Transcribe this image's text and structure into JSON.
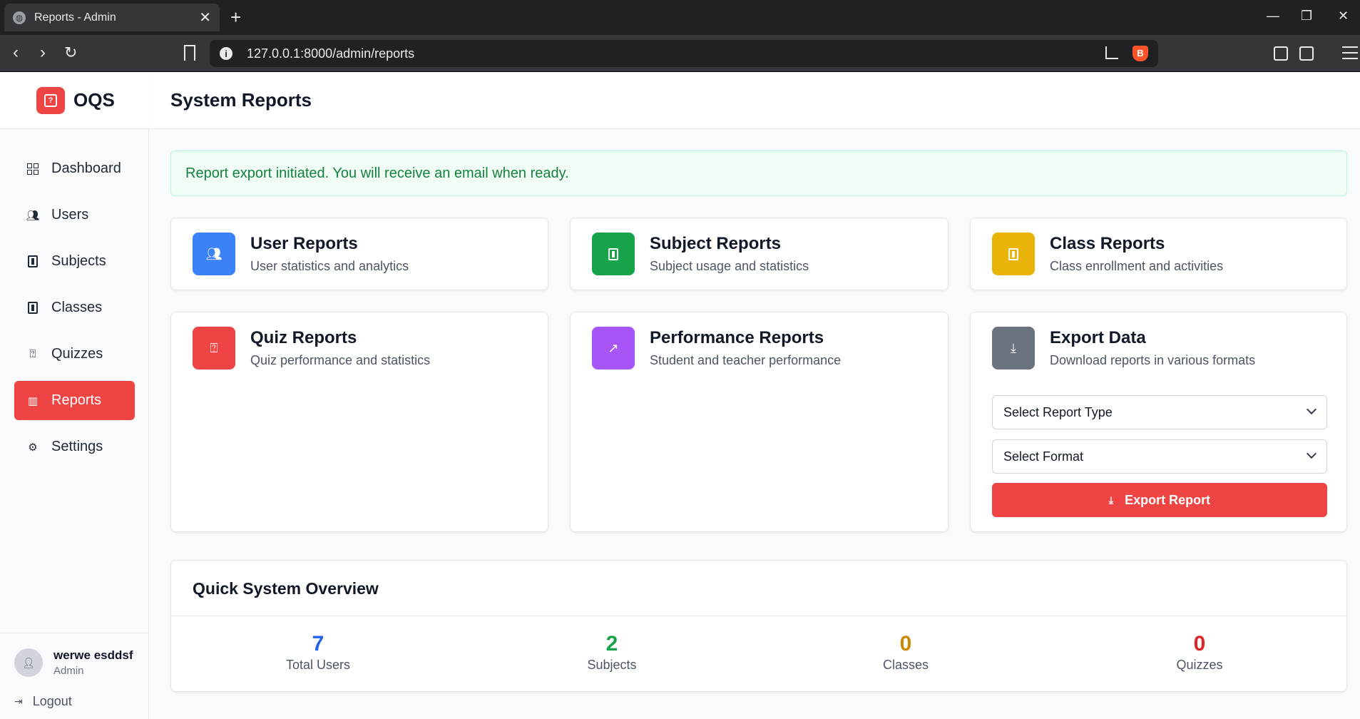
{
  "browser": {
    "tab_title": "Reports - Admin",
    "url": "127.0.0.1:8000/admin/reports"
  },
  "brand": {
    "name": "OQS"
  },
  "sidebar": {
    "items": [
      {
        "label": "Dashboard",
        "icon": "dashboard-icon"
      },
      {
        "label": "Users",
        "icon": "users-icon"
      },
      {
        "label": "Subjects",
        "icon": "book-icon"
      },
      {
        "label": "Classes",
        "icon": "book-icon"
      },
      {
        "label": "Quizzes",
        "icon": "quiz-icon"
      },
      {
        "label": "Reports",
        "icon": "chart-icon",
        "active": true
      },
      {
        "label": "Settings",
        "icon": "gear-icon"
      }
    ],
    "user": {
      "name": "werwe esddsf",
      "role": "Admin"
    },
    "logout_label": "Logout"
  },
  "header": {
    "title": "System Reports"
  },
  "alert": {
    "message": "Report export initiated. You will receive an email when ready."
  },
  "cards": [
    {
      "title": "User Reports",
      "subtitle": "User statistics and analytics",
      "color": "#3b82f6",
      "icon": "users-icon"
    },
    {
      "title": "Subject Reports",
      "subtitle": "Subject usage and statistics",
      "color": "#16a34a",
      "icon": "book-icon"
    },
    {
      "title": "Class Reports",
      "subtitle": "Class enrollment and activities",
      "color": "#eab308",
      "icon": "book-icon"
    },
    {
      "title": "Quiz Reports",
      "subtitle": "Quiz performance and statistics",
      "color": "#ef4444",
      "icon": "quiz-icon"
    },
    {
      "title": "Performance Reports",
      "subtitle": "Student and teacher performance",
      "color": "#a855f7",
      "icon": "trend-icon"
    },
    {
      "title": "Export Data",
      "subtitle": "Download reports in various formats",
      "color": "#6b7280",
      "icon": "download-icon"
    }
  ],
  "export": {
    "report_type_selected": "Select Report Type",
    "format_selected": "Select Format",
    "button_label": "Export Report"
  },
  "overview": {
    "title": "Quick System Overview",
    "stats": [
      {
        "value": "7",
        "label": "Total Users",
        "color": "#2563eb"
      },
      {
        "value": "2",
        "label": "Subjects",
        "color": "#16a34a"
      },
      {
        "value": "0",
        "label": "Classes",
        "color": "#ca8a04"
      },
      {
        "value": "0",
        "label": "Quizzes",
        "color": "#dc2626"
      }
    ]
  }
}
